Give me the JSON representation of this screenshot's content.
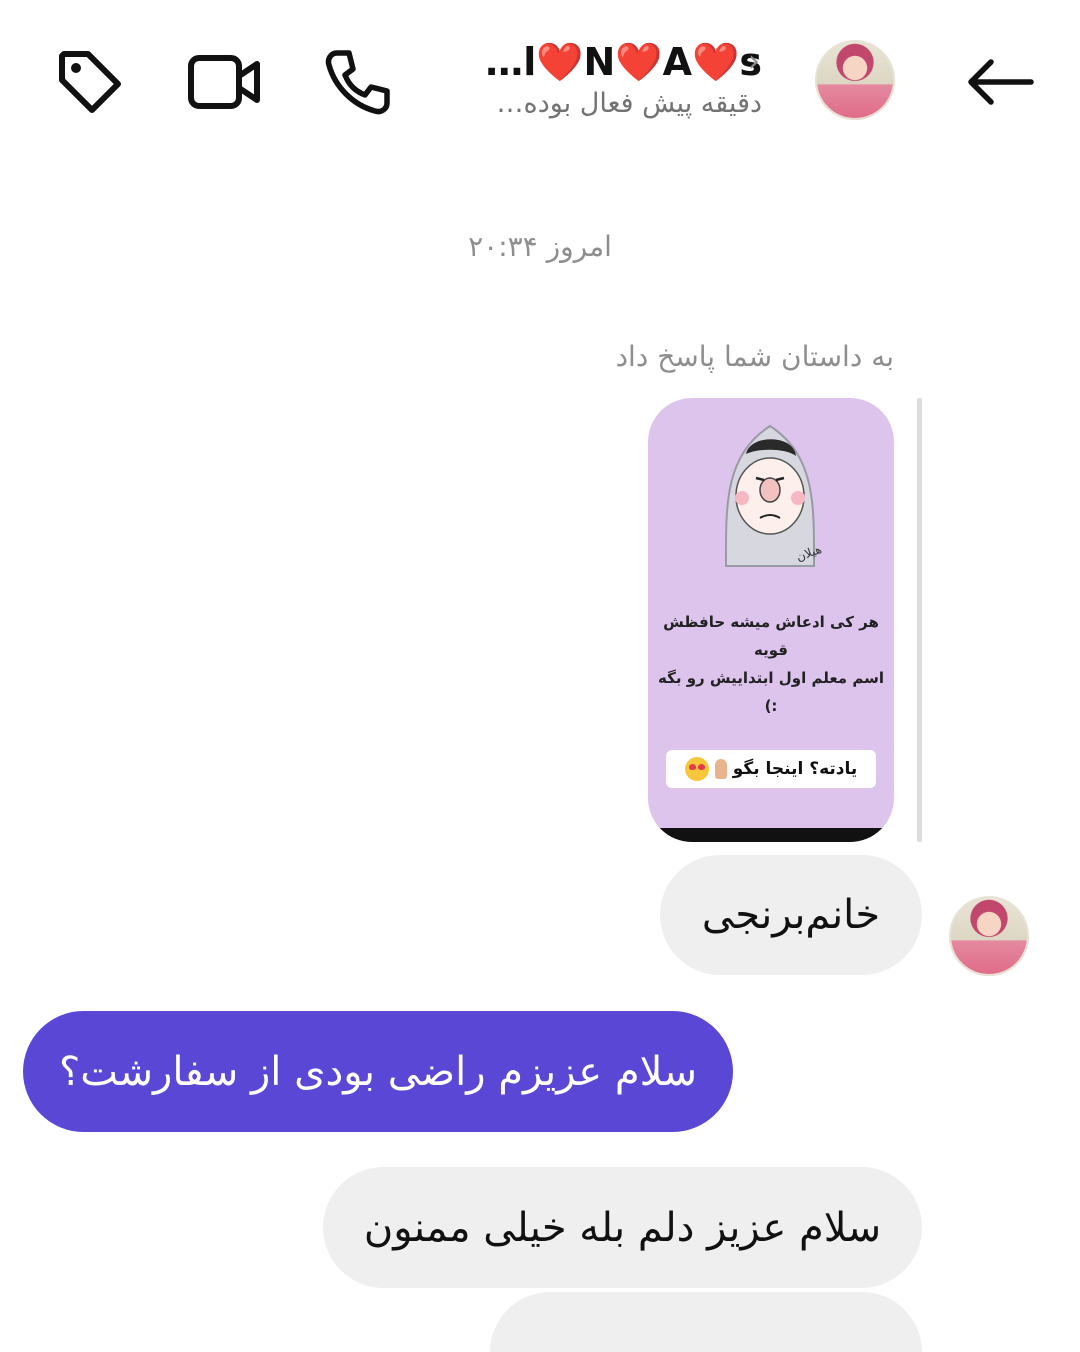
{
  "header": {
    "contact_name": "…l❤️N❤️A❤️s",
    "status": "دقیقه پیش فعال بوده…",
    "chevron": "›",
    "icons": [
      "tag-icon",
      "video-call-icon",
      "phone-icon",
      "back-arrow-icon"
    ]
  },
  "thread": {
    "timestamp": "امروز ۲۰:۳۴",
    "reply_note": "به داستان شما پاسخ داد",
    "story": {
      "caption_line1": "هر کی ادعاش میشه حافظش قویه",
      "caption_line2": "اسم معلم اول ابتداییش رو بگه :)",
      "sticker_text": "یادته؟ اینجا بگو",
      "signature": "هیلان"
    },
    "messages": [
      {
        "side": "incoming",
        "text": "خانم‌برنجی"
      },
      {
        "side": "outgoing",
        "text": "سلام عزیزم راضی بودی از سفارشت؟"
      },
      {
        "side": "incoming",
        "text": "سلام عزیز دلم بله خیلی ممنون"
      }
    ]
  },
  "colors": {
    "outgoing_bubble": "#5b47d6",
    "incoming_bubble": "#efefef",
    "story_background": "#ddc4ec"
  }
}
